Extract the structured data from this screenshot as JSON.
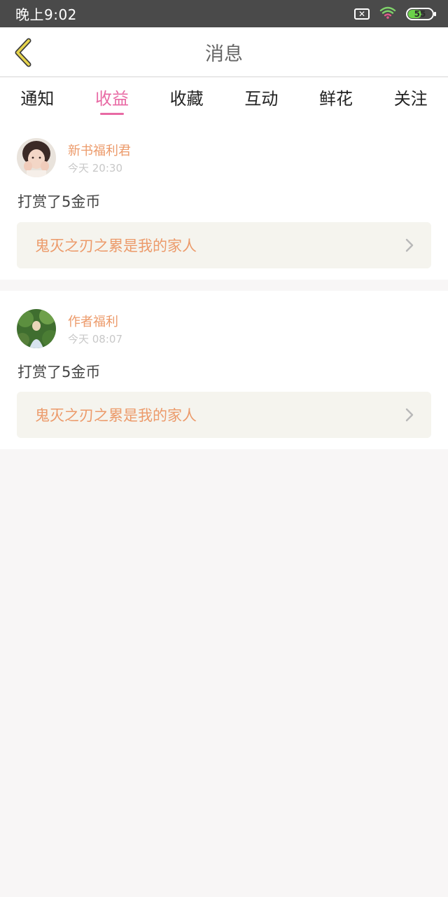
{
  "status_bar": {
    "time": "晚上9:02",
    "battery": "55"
  },
  "header": {
    "title": "消息",
    "back_icon": "chevron-left-icon"
  },
  "tabs": [
    {
      "label": "通知",
      "active": false
    },
    {
      "label": "收益",
      "active": true
    },
    {
      "label": "收藏",
      "active": false
    },
    {
      "label": "互动",
      "active": false
    },
    {
      "label": "鲜花",
      "active": false
    },
    {
      "label": "关注",
      "active": false
    }
  ],
  "messages": [
    {
      "sender": "新书福利君",
      "time": "今天 20:30",
      "text": "打赏了5金币",
      "book_title": "鬼灭之刃之累是我的家人"
    },
    {
      "sender": "作者福利",
      "time": "今天 08:07",
      "text": "打赏了5金币",
      "book_title": "鬼灭之刃之累是我的家人"
    }
  ],
  "colors": {
    "accent": "#e86aa4",
    "highlight": "#ec9a6a",
    "status_bar": "#4a4a4a",
    "back_arrow": "#d9bc3a"
  }
}
